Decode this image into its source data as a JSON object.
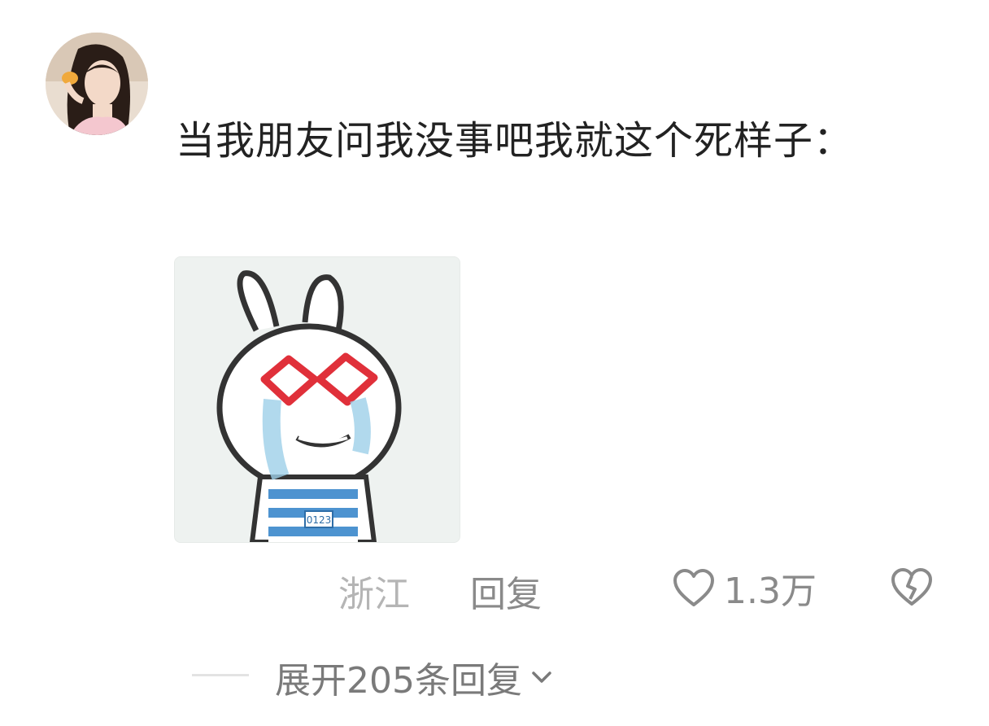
{
  "comment": {
    "avatar_icon": "user-avatar",
    "text": "当我朋友问我没事吧我就这个死样子：",
    "sticker_icon": "bunny-sticker",
    "sticker_badge": "0123",
    "location": "浙江",
    "reply_label": "回复",
    "like_icon": "heart-outline-icon",
    "like_count": "1.3万",
    "dislike_icon": "broken-heart-icon",
    "expand_label": "展开205条回复",
    "expand_icon": "chevron-down-icon"
  }
}
